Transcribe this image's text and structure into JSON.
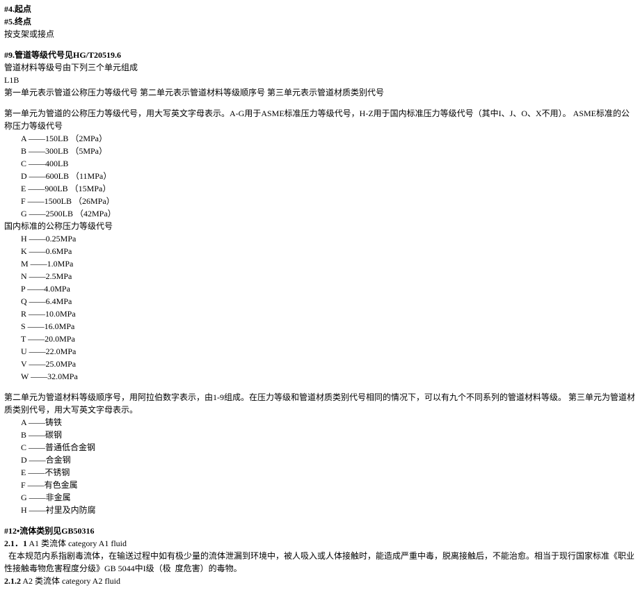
{
  "header": {
    "l1": "#4.起点",
    "l2": "#5.终点",
    "l3": "按支架或接点"
  },
  "sec9": {
    "title": "#9.管道等级代号见HG/T20519.6",
    "intro1": "管道材料等级号由下列三个单元组成",
    "intro2": "L1B",
    "intro3": "第一单元表示管道公称压力等级代号  第二单元表示管道材料等级顺序号  第三单元表示管道材质类别代号",
    "unit1_title": "第一单元为管道的公称压力等级代号，用大写英文字母表示。A-G用于ASME标准压力等级代号，H-Z用于国内标准压力等级代号（其中I、J、O、X不用）。 ASME标准的公称压力等级代号",
    "asme": [
      "A ——150LB （2MPa）",
      "B ——300LB （5MPa）",
      "C ——400LB",
      "D ——600LB （11MPa）",
      "E ——900LB （15MPa）",
      "F ——1500LB （26MPa）",
      "G ——2500LB （42MPa）"
    ],
    "gb_title": "国内标准的公称压力等级代号",
    "gb": [
      "H ——0.25MPa",
      "K ——0.6MPa",
      "M ——1.0MPa",
      "N ——2.5MPa",
      "P ——4.0MPa",
      "Q ——6.4MPa",
      "R ——10.0MPa",
      "S ——16.0MPa",
      "T ——20.0MPa",
      "U ——22.0MPa",
      "V ——25.0MPa",
      "W ——32.0MPa"
    ],
    "unit2_title": "第二单元为管道材料等级顺序号，用阿拉伯数字表示，由1-9组成。在压力等级和管道材质类别代号相同的情况下，可以有九个不同系列的管道材料等级。  第三单元为管道材质类别代号，用大写英文字母表示。",
    "materials": [
      "A ——铸铁",
      "B ——碳钢",
      "C ——普通低合金钢",
      "D ——合金钢",
      "E ——不锈钢",
      "F ——有色金属",
      "G ——非金属",
      "H ——衬里及内防腐"
    ]
  },
  "sec12": {
    "title": "#12•流体类别见GB50316",
    "l211_a": "2.1．1",
    "l211_b": " A1 类流体   category A1 fluid",
    "p1": "  在本规范内系指剧毒流体，在输送过程中如有极少量的流体泄漏到环境中，被人吸入或人体接触时，能造成严重中毒，脱离接触后，不能治愈。相当于现行国家标准《职业性接触毒物危害程度分级》GB 5044中I级（极  度危害）的毒物。",
    "l212_a": "2.1.2",
    "l212_b": " A2 类流体  category A2 fluid"
  }
}
